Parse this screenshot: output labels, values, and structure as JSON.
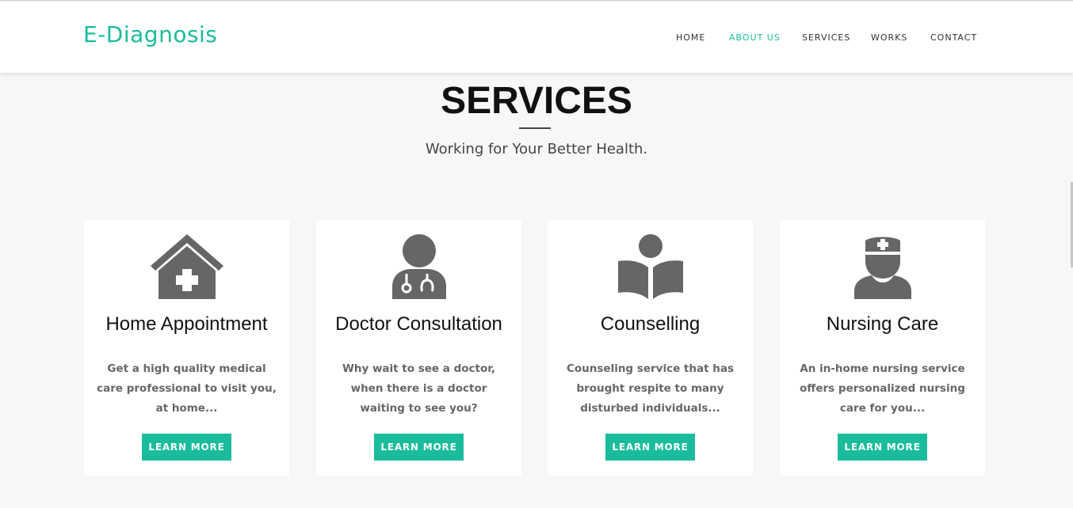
{
  "brand": "E-Diagnosis",
  "nav": {
    "items": [
      {
        "label": "HOME",
        "active": false
      },
      {
        "label": "ABOUT US",
        "active": true
      },
      {
        "label": "SERVICES",
        "active": false
      },
      {
        "label": "WORKS",
        "active": false
      },
      {
        "label": "CONTACT",
        "active": false
      }
    ]
  },
  "section": {
    "title": "SERVICES",
    "subtitle": "Working for Your Better Health."
  },
  "cards": [
    {
      "icon": "home-medical-icon",
      "title": "Home Appointment",
      "text": "Get a high quality medical care professional to visit you, at home...",
      "button": "LEARN MORE"
    },
    {
      "icon": "doctor-icon",
      "title": "Doctor Consultation",
      "text": "Why wait to see a doctor, when there is a doctor waiting to see you?",
      "button": "LEARN MORE"
    },
    {
      "icon": "reader-icon",
      "title": "Counselling",
      "text": "Counseling service that has brought respite to many disturbed individuals...",
      "button": "LEARN MORE"
    },
    {
      "icon": "nurse-icon",
      "title": "Nursing Care",
      "text": "An in-home nursing service offers personalized nursing care for you...",
      "button": "LEARN MORE"
    }
  ],
  "colors": {
    "accent": "#1abc9c",
    "icon": "#666666",
    "background": "#f7f7f7",
    "card": "#ffffff"
  }
}
